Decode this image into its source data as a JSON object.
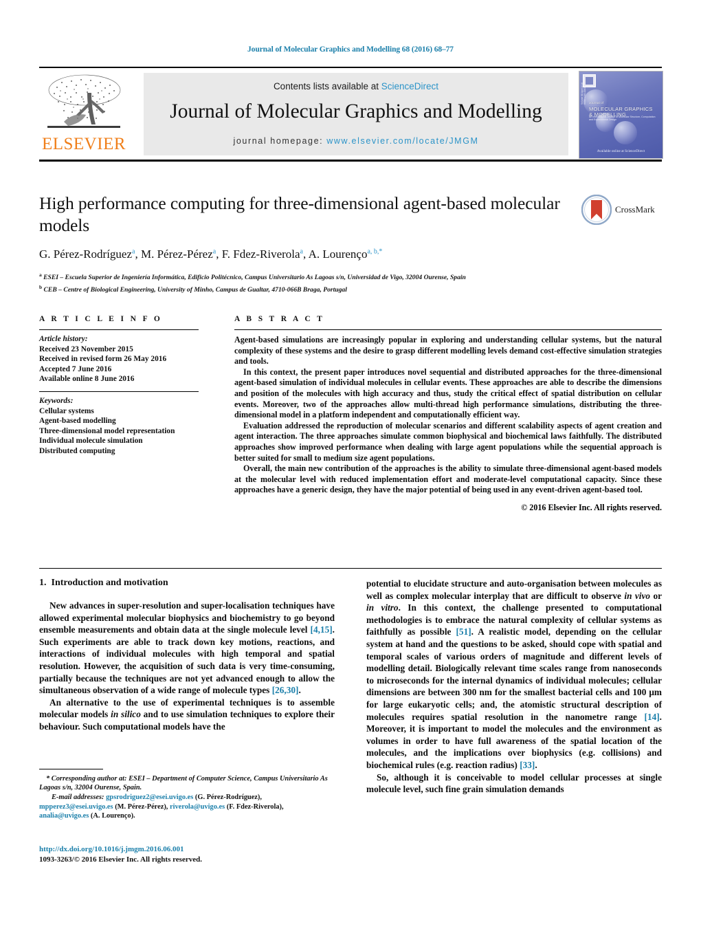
{
  "running_head": "Journal of Molecular Graphics and Modelling 68 (2016) 68–77",
  "masthead": {
    "contents_text": "Contents lists available at ",
    "sciencedirect": "ScienceDirect",
    "journal_title": "Journal of Molecular Graphics and Modelling",
    "homepage_label": "journal homepage: ",
    "homepage_url": "www.elsevier.com/locate/JMGM",
    "publisher": "ELSEVIER",
    "cover": {
      "title_small": "Journal of",
      "title_line1": "MOLECULAR GRAPHICS",
      "title_line2": "& MODELLING",
      "subtitle": "An International Journal of Molecular Structure, Computation and Experimental Design",
      "side_text": "Volume 68  April 2016  ISSN 1093-3263",
      "footer": "Available online at\nScienceDirect"
    }
  },
  "article": {
    "title": "High performance computing for three-dimensional agent-based molecular models",
    "authors": [
      {
        "name": "G. Pérez-Rodríguez",
        "sup": "a"
      },
      {
        "name": "M. Pérez-Pérez",
        "sup": "a"
      },
      {
        "name": "F. Fdez-Riverola",
        "sup": "a"
      },
      {
        "name": "A. Lourenço",
        "sup": "a, b,*"
      }
    ],
    "affiliations": [
      {
        "sup": "a",
        "text": "ESEI – Escuela Superior de Ingeniería Informática, Edificio Politécnico, Campus Universitario As Lagoas s/n, Universidad de Vigo, 32004 Ourense, Spain"
      },
      {
        "sup": "b",
        "text": "CEB – Centre of Biological Engineering, University of Minho, Campus de Gualtar, 4710-066B Braga, Portugal"
      }
    ],
    "crossmark_label": "CrossMark"
  },
  "info": {
    "heading": "A R T I C L E   I N F O",
    "history_label": "Article history:",
    "history": [
      "Received 23 November 2015",
      "Received in revised form 26 May 2016",
      "Accepted 7 June 2016",
      "Available online 8 June 2016"
    ],
    "keywords_label": "Keywords:",
    "keywords": [
      "Cellular systems",
      "Agent-based modelling",
      "Three-dimensional model representation",
      "Individual molecule simulation",
      "Distributed computing"
    ]
  },
  "abstract": {
    "heading": "A B S T R A C T",
    "paragraphs": [
      "Agent-based simulations are increasingly popular in exploring and understanding cellular systems, but the natural complexity of these systems and the desire to grasp different modelling levels demand cost-effective simulation strategies and tools.",
      "In this context, the present paper introduces novel sequential and distributed approaches for the three-dimensional agent-based simulation of individual molecules in cellular events. These approaches are able to describe the dimensions and position of the molecules with high accuracy and thus, study the critical effect of spatial distribution on cellular events. Moreover, two of the approaches allow multi-thread high performance simulations, distributing the three-dimensional model in a platform independent and computationally efficient way.",
      "Evaluation addressed the reproduction of molecular scenarios and different scalability aspects of agent creation and agent interaction. The three approaches simulate common biophysical and biochemical laws faithfully. The distributed approaches show improved performance when dealing with large agent populations while the sequential approach is better suited for small to medium size agent populations.",
      "Overall, the main new contribution of the approaches is the ability to simulate three-dimensional agent-based models at the molecular level with reduced implementation effort and moderate-level computational capacity. Since these approaches have a generic design, they have the major potential of being used in any event-driven agent-based tool."
    ],
    "copyright": "© 2016 Elsevier Inc. All rights reserved."
  },
  "body": {
    "section_number": "1.",
    "section_title": "Introduction and motivation",
    "left_paragraphs": [
      {
        "segments": [
          {
            "t": "New advances in super-resolution and super-localisation techniques have allowed experimental molecular biophysics and biochemistry to go beyond ensemble measurements and obtain data at the single molecule level "
          },
          {
            "t": "[4,15]",
            "style": "ref"
          },
          {
            "t": ". Such experiments are able to track down key motions, reactions, and interactions of individual molecules with high temporal and spatial resolution. However, the acquisition of such data is very time-consuming, partially because the techniques are not yet advanced enough to allow the simultaneous observation of a wide range of molecule types "
          },
          {
            "t": "[26,30]",
            "style": "ref"
          },
          {
            "t": "."
          }
        ]
      },
      {
        "segments": [
          {
            "t": "An alternative to the use of experimental techniques is to assemble molecular models "
          },
          {
            "t": "in silico",
            "style": "ital"
          },
          {
            "t": " and to use simulation techniques to explore their behaviour. Such computational models have the"
          }
        ]
      }
    ],
    "right_paragraphs": [
      {
        "noindent": true,
        "segments": [
          {
            "t": "potential to elucidate structure and auto-organisation between molecules as well as complex molecular interplay that are difficult to observe "
          },
          {
            "t": "in vivo",
            "style": "ital"
          },
          {
            "t": " or "
          },
          {
            "t": "in vitro",
            "style": "ital"
          },
          {
            "t": ". In this context, the challenge presented to computational methodologies is to embrace the natural complexity of cellular systems as faithfully as possible "
          },
          {
            "t": "[51]",
            "style": "ref"
          },
          {
            "t": ". A realistic model, depending on the cellular system at hand and the questions to be asked, should cope with spatial and temporal scales of various orders of magnitude and different levels of modelling detail. Biologically relevant time scales range from nanoseconds to microseconds for the internal dynamics of individual molecules; cellular dimensions are between 300 nm for the smallest bacterial cells and 100 μm for large eukaryotic cells; and, the atomistic structural description of molecules requires spatial resolution in the nanometre range "
          },
          {
            "t": "[14]",
            "style": "ref"
          },
          {
            "t": ". Moreover, it is important to model the molecules and the environment as volumes in order to have full awareness of the spatial location of the molecules, and the implications over biophysics (e.g. collisions) and biochemical rules (e.g. reaction radius) "
          },
          {
            "t": "[33]",
            "style": "ref"
          },
          {
            "t": "."
          }
        ]
      },
      {
        "segments": [
          {
            "t": "So, although it is conceivable to model cellular processes at single molecule level, such fine grain simulation demands"
          }
        ]
      }
    ]
  },
  "footnotes": {
    "corresponding": "* Corresponding author at: ESEI – Department of Computer Science, Campus Universitario As Lagoas s/n, 32004 Ourense, Spain.",
    "email_label": "E-mail addresses:",
    "emails": [
      {
        "address": "gpsrodriguez2@esei.uvigo.es",
        "author": "(G. Pérez-Rodríguez),"
      },
      {
        "address": "mpperez3@esei.uvigo.es",
        "author": "(M. Pérez-Pérez),"
      },
      {
        "address": "riverola@uvigo.es",
        "author": "(F. Fdez-Riverola),"
      },
      {
        "address": "analia@uvigo.es",
        "author": "(A. Lourenço)."
      }
    ]
  },
  "bottom": {
    "doi": "http://dx.doi.org/10.1016/j.jmgm.2016.06.001",
    "issn_line": "1093-3263/© 2016 Elsevier Inc. All rights reserved."
  },
  "colors": {
    "link": "#1b7faa",
    "sciencedirect": "#2b93c8",
    "elsevier_orange": "#f07f1a",
    "panel_grey": "#e9e9e9"
  }
}
